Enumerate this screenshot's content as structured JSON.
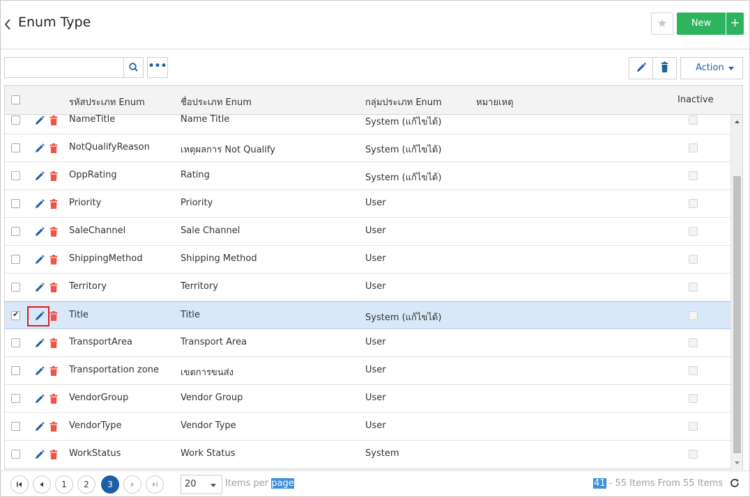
{
  "header": {
    "back_glyph": "‹",
    "title": "Enum Type",
    "star_icon": "star-icon",
    "new_label": "New",
    "new_plus": "+"
  },
  "toolbar": {
    "search_placeholder": "",
    "more_label": "•••",
    "action_label": "Action"
  },
  "grid": {
    "columns": [
      "รหัสประเภท Enum",
      "ชื่อประเภท Enum",
      "กลุ่มประเภท Enum",
      "หมายเหตุ",
      "Inactive"
    ],
    "rows": [
      {
        "code": "NameTitle",
        "name": "Name Title",
        "group": "System (แก้ไขได้)",
        "note": "",
        "selected": false
      },
      {
        "code": "NotQualifyReason",
        "name": "เหตุผลการ Not Qualify",
        "group": "System (แก้ไขได้)",
        "note": "",
        "selected": false
      },
      {
        "code": "OppRating",
        "name": "Rating",
        "group": "System (แก้ไขได้)",
        "note": "",
        "selected": false
      },
      {
        "code": "Priority",
        "name": "Priority",
        "group": "User",
        "note": "",
        "selected": false
      },
      {
        "code": "SaleChannel",
        "name": "Sale Channel",
        "group": "User",
        "note": "",
        "selected": false
      },
      {
        "code": "ShippingMethod",
        "name": "Shipping Method",
        "group": "User",
        "note": "",
        "selected": false
      },
      {
        "code": "Territory",
        "name": "Territory",
        "group": "User",
        "note": "",
        "selected": false
      },
      {
        "code": "Title",
        "name": "Title",
        "group": "System (แก้ไขได้)",
        "note": "",
        "selected": true
      },
      {
        "code": "TransportArea",
        "name": "Transport Area",
        "group": "User",
        "note": "",
        "selected": false
      },
      {
        "code": "Transportation zone",
        "name": "เขตการขนส่ง",
        "group": "User",
        "note": "",
        "selected": false
      },
      {
        "code": "VendorGroup",
        "name": "Vendor Group",
        "group": "User",
        "note": "",
        "selected": false
      },
      {
        "code": "VendorType",
        "name": "Vendor Type",
        "group": "User",
        "note": "",
        "selected": false
      },
      {
        "code": "WorkStatus",
        "name": "Work Status",
        "group": "System",
        "note": "",
        "selected": false
      }
    ]
  },
  "pager": {
    "pages": [
      "1",
      "2",
      "3"
    ],
    "active_page": "3",
    "per_page_value": "20",
    "per_page_label_a": "Items per ",
    "per_page_label_b": "page",
    "items_range_start": "41",
    "items_info_rest": " - 55 Items From 55 Items"
  },
  "colors": {
    "primary_blue": "#1d5fa7",
    "new_green": "#2eb45f",
    "delete_red": "#e8584a",
    "selected_row": "#d9e8f8",
    "highlight_red": "#e01b1b"
  }
}
